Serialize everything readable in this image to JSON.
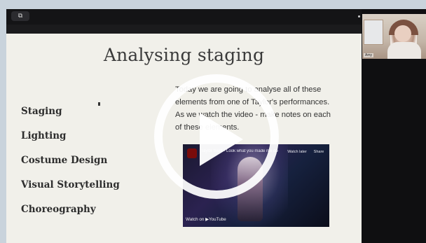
{
  "meeting": {
    "toolbar_icon": "screen-share-icon",
    "participant_name": "Amy"
  },
  "slide": {
    "title": "Analysing staging",
    "topics": [
      "Staging",
      "Lighting",
      "Costume Design",
      "Visual Storytelling",
      "Choreography"
    ],
    "body_lines": [
      "Today we are going to analyse all of these",
      "elements from one of Taylor's performances.",
      "As we watch the video - make notes on each",
      "of these elements."
    ]
  },
  "video": {
    "title": "Taylor Swift - Look what you made me do",
    "watch_later": "Watch later",
    "share": "Share",
    "watch_on": "Watch on ▶YouTube"
  },
  "colors": {
    "slide_bg": "#f1f0ea",
    "frame_bg": "#0f0f11",
    "page_bg": "#c9d3dc",
    "play_overlay": "#ffffff"
  }
}
